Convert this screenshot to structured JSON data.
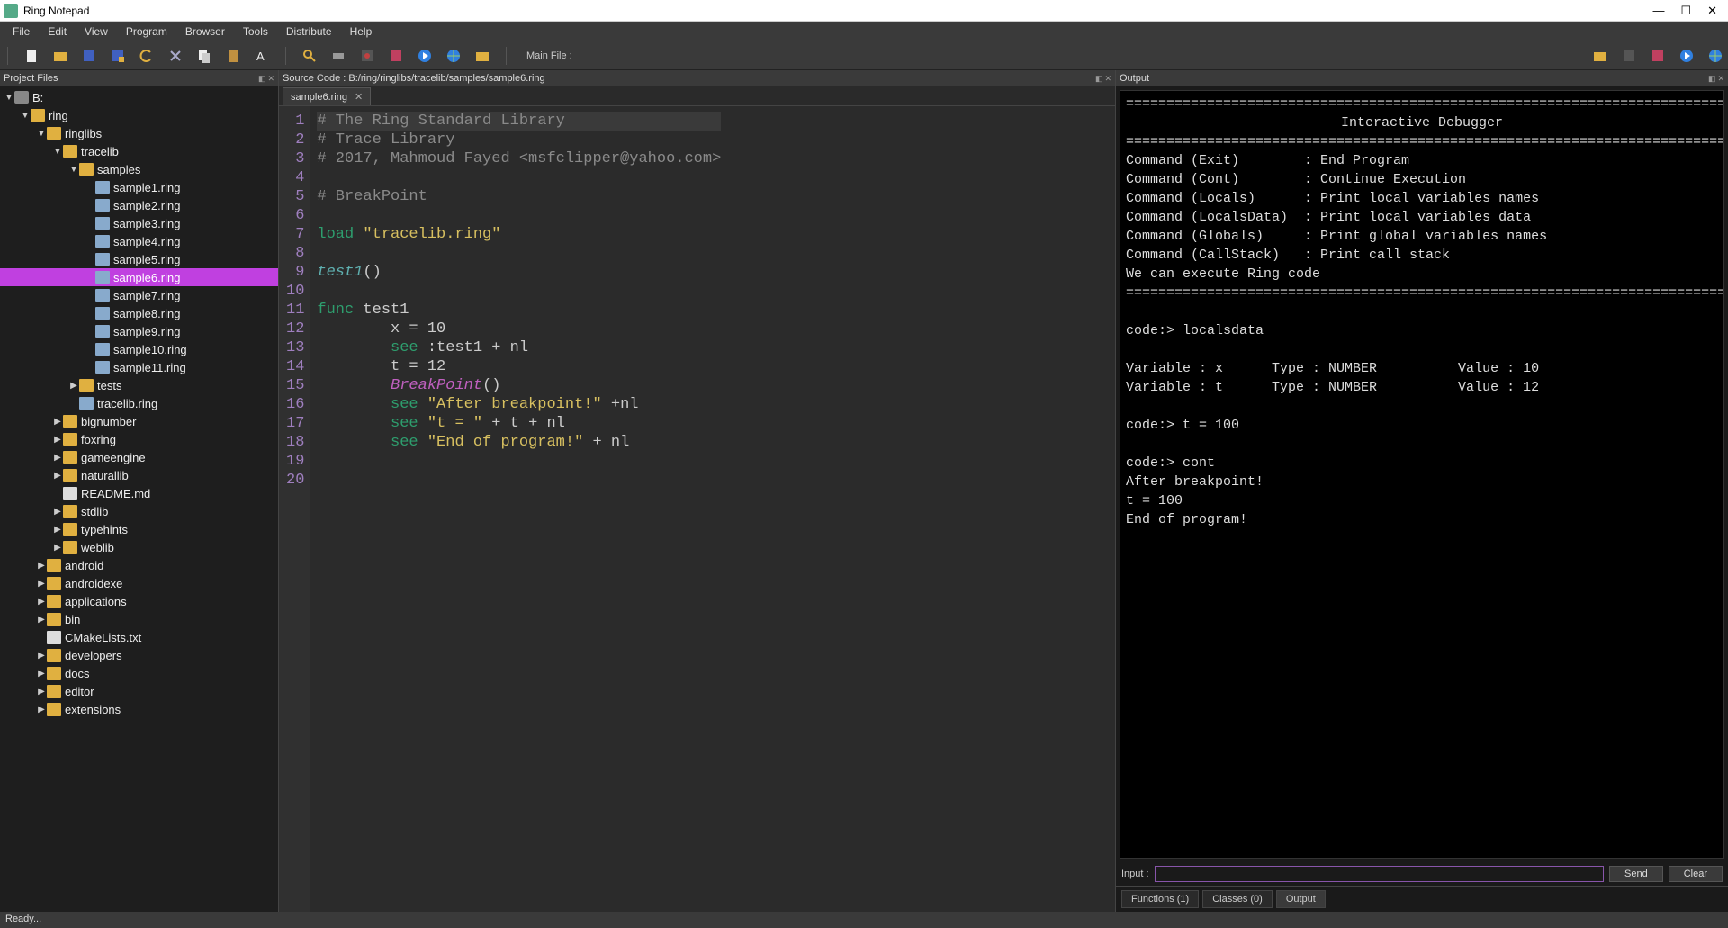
{
  "window": {
    "title": "Ring Notepad"
  },
  "menu": [
    "File",
    "Edit",
    "View",
    "Program",
    "Browser",
    "Tools",
    "Distribute",
    "Help"
  ],
  "toolbar": {
    "mainfile_label": "Main File :"
  },
  "panels": {
    "project": {
      "title": "Project Files"
    },
    "source": {
      "title_prefix": "Source Code : ",
      "path": "B:/ring/ringlibs/tracelib/samples/sample6.ring"
    },
    "output": {
      "title": "Output"
    }
  },
  "tree": {
    "root": "B:",
    "items": [
      {
        "depth": 0,
        "type": "drive",
        "expanded": true,
        "label": "B:"
      },
      {
        "depth": 1,
        "type": "folder",
        "expanded": true,
        "label": "ring"
      },
      {
        "depth": 2,
        "type": "folder",
        "expanded": true,
        "label": "ringlibs"
      },
      {
        "depth": 3,
        "type": "folder",
        "expanded": true,
        "label": "tracelib"
      },
      {
        "depth": 4,
        "type": "folder",
        "expanded": true,
        "label": "samples"
      },
      {
        "depth": 5,
        "type": "file",
        "label": "sample1.ring"
      },
      {
        "depth": 5,
        "type": "file",
        "label": "sample2.ring"
      },
      {
        "depth": 5,
        "type": "file",
        "label": "sample3.ring"
      },
      {
        "depth": 5,
        "type": "file",
        "label": "sample4.ring"
      },
      {
        "depth": 5,
        "type": "file",
        "label": "sample5.ring"
      },
      {
        "depth": 5,
        "type": "file",
        "label": "sample6.ring",
        "selected": true
      },
      {
        "depth": 5,
        "type": "file",
        "label": "sample7.ring"
      },
      {
        "depth": 5,
        "type": "file",
        "label": "sample8.ring"
      },
      {
        "depth": 5,
        "type": "file",
        "label": "sample9.ring"
      },
      {
        "depth": 5,
        "type": "file",
        "label": "sample10.ring"
      },
      {
        "depth": 5,
        "type": "file",
        "label": "sample11.ring"
      },
      {
        "depth": 4,
        "type": "folder",
        "collapsed": true,
        "label": "tests"
      },
      {
        "depth": 4,
        "type": "file",
        "label": "tracelib.ring"
      },
      {
        "depth": 3,
        "type": "folder",
        "collapsed": true,
        "label": "bignumber"
      },
      {
        "depth": 3,
        "type": "folder",
        "collapsed": true,
        "label": "foxring"
      },
      {
        "depth": 3,
        "type": "folder",
        "collapsed": true,
        "label": "gameengine"
      },
      {
        "depth": 3,
        "type": "folder",
        "collapsed": true,
        "label": "naturallib"
      },
      {
        "depth": 3,
        "type": "filetxt",
        "label": "README.md"
      },
      {
        "depth": 3,
        "type": "folder",
        "collapsed": true,
        "label": "stdlib"
      },
      {
        "depth": 3,
        "type": "folder",
        "collapsed": true,
        "label": "typehints"
      },
      {
        "depth": 3,
        "type": "folder",
        "collapsed": true,
        "label": "weblib"
      },
      {
        "depth": 2,
        "type": "folder",
        "collapsed": true,
        "label": "android"
      },
      {
        "depth": 2,
        "type": "folder",
        "collapsed": true,
        "label": "androidexe"
      },
      {
        "depth": 2,
        "type": "folder",
        "collapsed": true,
        "label": "applications"
      },
      {
        "depth": 2,
        "type": "folder",
        "collapsed": true,
        "label": "bin"
      },
      {
        "depth": 2,
        "type": "filetxt",
        "label": "CMakeLists.txt"
      },
      {
        "depth": 2,
        "type": "folder",
        "collapsed": true,
        "label": "developers"
      },
      {
        "depth": 2,
        "type": "folder",
        "collapsed": true,
        "label": "docs"
      },
      {
        "depth": 2,
        "type": "folder",
        "collapsed": true,
        "label": "editor"
      },
      {
        "depth": 2,
        "type": "folder",
        "collapsed": true,
        "label": "extensions"
      }
    ]
  },
  "editor": {
    "tab": "sample6.ring",
    "lines": [
      {
        "n": 1,
        "cur": true,
        "segs": [
          {
            "cls": "c-comment",
            "t": "# The Ring Standard Library"
          }
        ]
      },
      {
        "n": 2,
        "segs": [
          {
            "cls": "c-comment",
            "t": "# Trace Library"
          }
        ]
      },
      {
        "n": 3,
        "segs": [
          {
            "cls": "c-comment",
            "t": "# 2017, Mahmoud Fayed <msfclipper@yahoo.com>"
          }
        ]
      },
      {
        "n": 4,
        "segs": []
      },
      {
        "n": 5,
        "segs": [
          {
            "cls": "c-comment",
            "t": "# BreakPoint"
          }
        ]
      },
      {
        "n": 6,
        "segs": []
      },
      {
        "n": 7,
        "segs": [
          {
            "cls": "c-kw",
            "t": "load "
          },
          {
            "cls": "c-str",
            "t": "\"tracelib.ring\""
          }
        ]
      },
      {
        "n": 8,
        "segs": []
      },
      {
        "n": 9,
        "segs": [
          {
            "cls": "c-func",
            "t": "test1"
          },
          {
            "t": "()"
          }
        ]
      },
      {
        "n": 10,
        "segs": []
      },
      {
        "n": 11,
        "segs": [
          {
            "cls": "c-kw",
            "t": "func "
          },
          {
            "t": "test1"
          }
        ]
      },
      {
        "n": 12,
        "segs": [
          {
            "t": "        x = 10"
          }
        ]
      },
      {
        "n": 13,
        "segs": [
          {
            "t": "        "
          },
          {
            "cls": "c-kw",
            "t": "see "
          },
          {
            "t": ":test1 + nl"
          }
        ]
      },
      {
        "n": 14,
        "segs": [
          {
            "t": "        t = 12"
          }
        ]
      },
      {
        "n": 15,
        "segs": [
          {
            "t": "        "
          },
          {
            "cls": "c-call",
            "t": "BreakPoint"
          },
          {
            "t": "()"
          }
        ]
      },
      {
        "n": 16,
        "segs": [
          {
            "t": "        "
          },
          {
            "cls": "c-kw",
            "t": "see "
          },
          {
            "cls": "c-str",
            "t": "\"After breakpoint!\""
          },
          {
            "t": " +nl"
          }
        ]
      },
      {
        "n": 17,
        "segs": [
          {
            "t": "        "
          },
          {
            "cls": "c-kw",
            "t": "see "
          },
          {
            "cls": "c-str",
            "t": "\"t = \""
          },
          {
            "t": " + t + nl"
          }
        ]
      },
      {
        "n": 18,
        "segs": [
          {
            "t": "        "
          },
          {
            "cls": "c-kw",
            "t": "see "
          },
          {
            "cls": "c-str",
            "t": "\"End of program!\""
          },
          {
            "t": " + nl"
          }
        ]
      },
      {
        "n": 19,
        "segs": []
      },
      {
        "n": 20,
        "segs": []
      }
    ]
  },
  "output": {
    "lines": [
      "===========================================================================",
      "Interactive Debugger",
      "===========================================================================",
      "Command (Exit)        : End Program",
      "Command (Cont)        : Continue Execution",
      "Command (Locals)      : Print local variables names",
      "Command (LocalsData)  : Print local variables data",
      "Command (Globals)     : Print global variables names",
      "Command (CallStack)   : Print call stack",
      "We can execute Ring code",
      "===========================================================================",
      "",
      "code:> localsdata",
      "",
      "Variable : x      Type : NUMBER          Value : 10",
      "Variable : t      Type : NUMBER          Value : 12",
      "",
      "code:> t = 100",
      "",
      "code:> cont",
      "After breakpoint!",
      "t = 100",
      "End of program!"
    ],
    "input_label": "Input :",
    "send": "Send",
    "clear": "Clear",
    "tabs": [
      "Functions (1)",
      "Classes (0)",
      "Output"
    ]
  },
  "status": "Ready..."
}
